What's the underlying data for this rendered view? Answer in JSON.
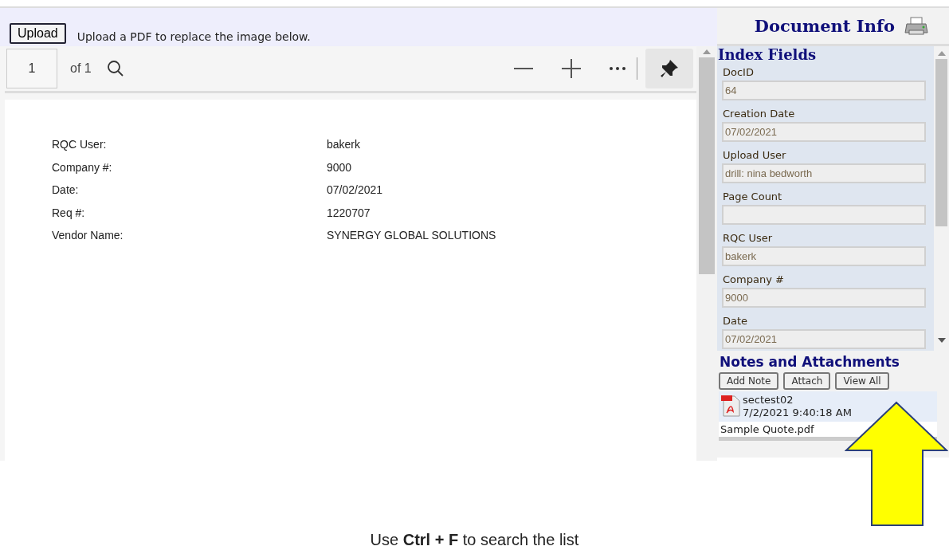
{
  "upload": {
    "button": "Upload",
    "hint": "Upload a PDF to replace the image below."
  },
  "viewer": {
    "page": "1",
    "page_total": "of 1"
  },
  "document": {
    "rows": [
      {
        "label": "RQC User:",
        "value": "bakerk"
      },
      {
        "label": "Company #:",
        "value": "9000"
      },
      {
        "label": "Date:",
        "value": "07/02/2021"
      },
      {
        "label": "Req #:",
        "value": "1220707"
      },
      {
        "label": "Vendor Name:",
        "value": "SYNERGY GLOBAL SOLUTIONS"
      }
    ]
  },
  "document_info": {
    "title": "Document Info",
    "index_fields": {
      "title": "Index Fields",
      "fields": [
        {
          "label": "DocID",
          "value": "64"
        },
        {
          "label": "Creation Date",
          "value": "07/02/2021"
        },
        {
          "label": "Upload User",
          "value": "drill: nina bedworth"
        },
        {
          "label": "Page Count"
        },
        {
          "label": "RQC User",
          "value": "bakerk"
        },
        {
          "label": "Company #",
          "value": "9000"
        },
        {
          "label": "Date",
          "value": "07/02/2021"
        }
      ]
    },
    "notes": {
      "title": "Notes and Attachments",
      "buttons": [
        "Add Note",
        "Attach",
        "View All"
      ],
      "items": [
        {
          "author": "sectest02",
          "time": "7/2/2021 9:40:18 AM",
          "file": "Sample Quote.pdf"
        }
      ]
    }
  },
  "caption": "Use **Ctrl + F** to search the list"
}
